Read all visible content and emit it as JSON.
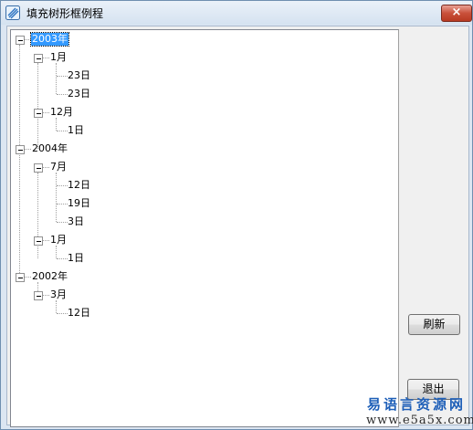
{
  "window": {
    "title": "填充树形框例程",
    "close_label": "×"
  },
  "tree": {
    "nodes": [
      {
        "label": "2003年",
        "selected": true
      },
      {
        "label": "1月"
      },
      {
        "label": "23日"
      },
      {
        "label": "23日"
      },
      {
        "label": "12月"
      },
      {
        "label": "1日"
      },
      {
        "label": "2004年"
      },
      {
        "label": "7月"
      },
      {
        "label": "12日"
      },
      {
        "label": "19日"
      },
      {
        "label": "3日"
      },
      {
        "label": "1月"
      },
      {
        "label": "1日"
      },
      {
        "label": "2002年"
      },
      {
        "label": "3月"
      },
      {
        "label": "12日"
      }
    ]
  },
  "buttons": {
    "refresh": "刷新",
    "exit": "退出"
  },
  "watermark": {
    "line1": "易语言资源网",
    "line2": "www.e5a5x.com"
  },
  "colors": {
    "selection": "#3399ff",
    "titlebar": "#d5e2f0",
    "close": "#c9503a"
  }
}
